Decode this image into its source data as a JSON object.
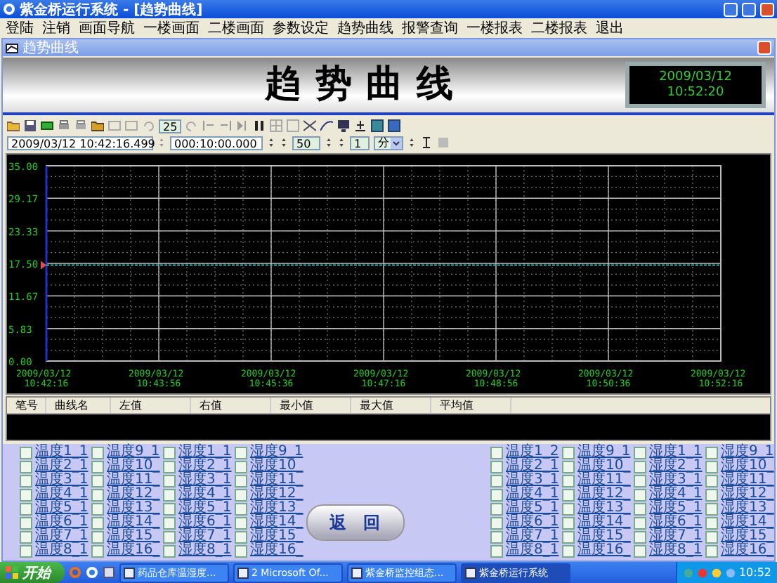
{
  "window": {
    "title": "紫金桥运行系统 - [趋势曲线]"
  },
  "menu": [
    "登陆",
    "注销",
    "画面导航",
    "一楼画面",
    "二楼画面",
    "参数设定",
    "趋势曲线",
    "报警查询",
    "一楼报表",
    "二楼报表",
    "退出"
  ],
  "child_window": {
    "title": "趋势曲线"
  },
  "header": {
    "title": "趋势曲线",
    "date": "2009/03/12",
    "time": "10:52:20"
  },
  "toolbar": {
    "zoom": "25",
    "start_time": "2009/03/12 10:42:16.499",
    "span": "000:10:00.000",
    "percent": "50",
    "step": "1",
    "unit": "分"
  },
  "chart": {
    "chart_data": {
      "type": "line",
      "grid": true,
      "x": [
        "2009/03/12 10:42:16",
        "2009/03/12 10:43:56",
        "2009/03/12 10:45:36",
        "2009/03/12 10:47:16",
        "2009/03/12 10:48:56",
        "2009/03/12 10:50:36",
        "2009/03/12 10:52:16"
      ],
      "ylim": [
        0,
        35
      ],
      "yticks": [
        {
          "value": 35,
          "label": "35.00"
        },
        {
          "value": 29.17,
          "label": "29.17"
        },
        {
          "value": 23.33,
          "label": "23.33"
        },
        {
          "value": 17.5,
          "label": "17.50"
        },
        {
          "value": 11.67,
          "label": "11.67"
        },
        {
          "value": 5.83,
          "label": "5.83"
        },
        {
          "value": 0,
          "label": "0.00"
        }
      ],
      "series": [
        {
          "color": "#40c8c8",
          "line_style": "dashed",
          "values": [
            17.2,
            17.2,
            17.2,
            17.2,
            17.2,
            17.2,
            17.2
          ]
        }
      ]
    }
  },
  "pen_table": {
    "columns": [
      "笔号",
      "曲线名",
      "左值",
      "右值",
      "最小值",
      "最大值",
      "平均值"
    ]
  },
  "check_groups": [
    {
      "columns": [
        [
          {
            "label": "温度1_1",
            "checked": false
          },
          {
            "label": "温度2_1",
            "checked": false
          },
          {
            "label": "温度3_1",
            "checked": false
          },
          {
            "label": "温度4_1",
            "checked": false
          },
          {
            "label": "温度5_1",
            "checked": false
          },
          {
            "label": "温度6_1",
            "checked": false
          },
          {
            "label": "温度7_1",
            "checked": false
          },
          {
            "label": "温度8_1",
            "checked": false
          }
        ],
        [
          {
            "label": "温度9_1",
            "checked": false
          },
          {
            "label": "温度10_",
            "checked": false
          },
          {
            "label": "温度11_",
            "checked": false
          },
          {
            "label": "温度12_",
            "checked": false
          },
          {
            "label": "温度13_",
            "checked": false
          },
          {
            "label": "温度14_",
            "checked": false
          },
          {
            "label": "温度15_",
            "checked": false
          },
          {
            "label": "温度16_",
            "checked": false
          }
        ],
        [
          {
            "label": "湿度1_1",
            "checked": false
          },
          {
            "label": "湿度2_1",
            "checked": false
          },
          {
            "label": "湿度3_1",
            "checked": false
          },
          {
            "label": "湿度4_1",
            "checked": false
          },
          {
            "label": "湿度5_1",
            "checked": false
          },
          {
            "label": "湿度6_1",
            "checked": false
          },
          {
            "label": "湿度7_1",
            "checked": false
          },
          {
            "label": "湿度8_1",
            "checked": false
          }
        ],
        [
          {
            "label": "湿度9_1",
            "checked": false
          },
          {
            "label": "湿度10_",
            "checked": false
          },
          {
            "label": "湿度11_",
            "checked": false
          },
          {
            "label": "湿度12_",
            "checked": false
          },
          {
            "label": "湿度13_",
            "checked": false
          },
          {
            "label": "湿度14_",
            "checked": false
          },
          {
            "label": "湿度15_",
            "checked": false
          },
          {
            "label": "湿度16_",
            "checked": false
          }
        ]
      ]
    },
    {
      "columns": [
        [
          {
            "label": "温度1_2",
            "checked": false
          },
          {
            "label": "温度2_1",
            "checked": false
          },
          {
            "label": "温度3_1",
            "checked": false
          },
          {
            "label": "温度4_1",
            "checked": false
          },
          {
            "label": "温度5_1",
            "checked": false
          },
          {
            "label": "温度6_1",
            "checked": false
          },
          {
            "label": "温度7_1",
            "checked": false
          },
          {
            "label": "温度8_1",
            "checked": false
          }
        ],
        [
          {
            "label": "温度9_1",
            "checked": false
          },
          {
            "label": "温度10_",
            "checked": false
          },
          {
            "label": "温度11_",
            "checked": false
          },
          {
            "label": "温度12_",
            "checked": false
          },
          {
            "label": "温度13_",
            "checked": false
          },
          {
            "label": "温度14_",
            "checked": false
          },
          {
            "label": "温度15_",
            "checked": false
          },
          {
            "label": "温度16_",
            "checked": false
          }
        ],
        [
          {
            "label": "湿度1_1",
            "checked": false
          },
          {
            "label": "湿度2_1",
            "checked": false
          },
          {
            "label": "湿度3_1",
            "checked": false
          },
          {
            "label": "湿度4_1",
            "checked": false
          },
          {
            "label": "湿度5_1",
            "checked": false
          },
          {
            "label": "湿度6_1",
            "checked": false
          },
          {
            "label": "湿度7_1",
            "checked": false
          },
          {
            "label": "湿度8_1",
            "checked": false
          }
        ],
        [
          {
            "label": "湿度9_1",
            "checked": false
          },
          {
            "label": "湿度10_",
            "checked": false
          },
          {
            "label": "湿度11_",
            "checked": false
          },
          {
            "label": "湿度12_",
            "checked": false
          },
          {
            "label": "湿度13_",
            "checked": false
          },
          {
            "label": "湿度14_",
            "checked": false
          },
          {
            "label": "湿度15_",
            "checked": false
          },
          {
            "label": "湿度16_",
            "checked": false
          }
        ]
      ]
    }
  ],
  "return_button": "返回",
  "taskbar": {
    "start": "开始",
    "tasks": [
      {
        "label": "药品仓库温湿度...",
        "selected": false
      },
      {
        "label": "2 Microsoft Of...",
        "selected": false
      },
      {
        "label": "紫金桥监控组态...",
        "selected": false
      },
      {
        "label": "紫金桥运行系统",
        "selected": true
      }
    ],
    "clock": "10:52"
  }
}
